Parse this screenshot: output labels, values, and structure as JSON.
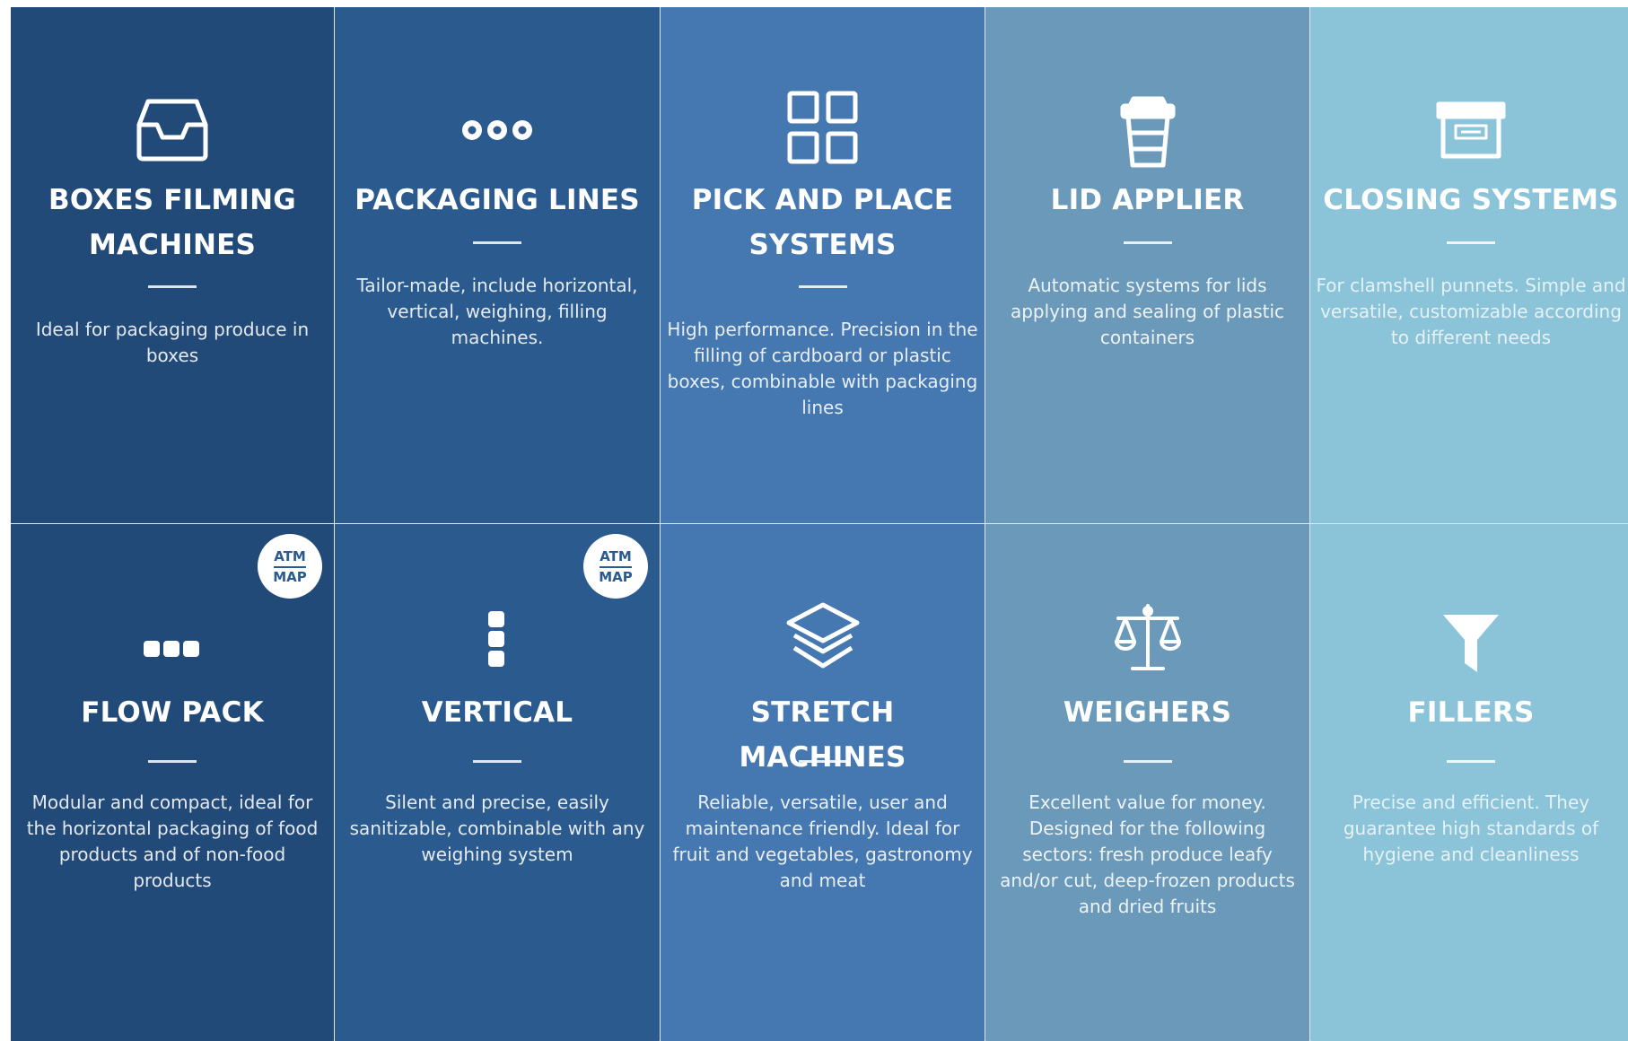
{
  "tiles": [
    {
      "title": [
        "BOXES FILMING",
        "MACHINES"
      ],
      "desc": [
        "Ideal for packaging produce in",
        "boxes"
      ],
      "icon": "inbox-tray-icon"
    },
    {
      "title": [
        "PACKAGING LINES"
      ],
      "desc": [
        "Tailor-made, include horizontal,",
        "vertical, weighing, filling",
        "machines."
      ],
      "icon": "three-dots-icon"
    },
    {
      "title": [
        "PICK AND PLACE",
        "SYSTEMS"
      ],
      "desc": [
        "High performance. Precision in the",
        "filling of cardboard or plastic",
        "boxes, combinable with packaging",
        "lines"
      ],
      "icon": "grid-squares-icon"
    },
    {
      "title": [
        "LID APPLIER"
      ],
      "desc": [
        "Automatic systems for lids",
        "applying and sealing of plastic",
        "containers"
      ],
      "icon": "cup-lid-icon"
    },
    {
      "title": [
        "CLOSING SYSTEMS"
      ],
      "desc": [
        "For clamshell punnets. Simple and",
        "versatile, customizable according",
        "to different needs"
      ],
      "icon": "archive-box-icon"
    },
    {
      "title": [
        "FLOW PACK"
      ],
      "desc": [
        "Modular and compact, ideal for",
        "the horizontal packaging of food",
        "products and of non-food",
        "products"
      ],
      "icon": "horizontal-squares-icon",
      "badge": [
        "ATM",
        "MAP"
      ]
    },
    {
      "title": [
        "VERTICAL"
      ],
      "desc": [
        "Silent and precise, easily",
        "sanitizable, combinable with any",
        "weighing system"
      ],
      "icon": "vertical-squares-icon",
      "badge": [
        "ATM",
        "MAP"
      ]
    },
    {
      "title": [
        "STRETCH MACHINES"
      ],
      "desc": [
        "Reliable, versatile, user and",
        "maintenance friendly. Ideal for",
        "fruit and vegetables, gastronomy",
        "and meat"
      ],
      "icon": "layers-icon"
    },
    {
      "title": [
        "WEIGHERS"
      ],
      "desc": [
        "Excellent value for money.",
        "Designed for the following",
        "sectors: fresh produce leafy",
        "and/or cut, deep-frozen products",
        "and dried fruits"
      ],
      "icon": "balance-scale-icon"
    },
    {
      "title": [
        "FILLERS"
      ],
      "desc": [
        "Precise and efficient. They",
        "guarantee high standards of",
        "hygiene and cleanliness"
      ],
      "icon": "funnel-icon"
    }
  ]
}
